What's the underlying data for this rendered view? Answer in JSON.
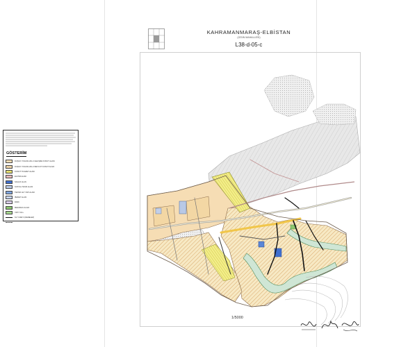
{
  "header": {
    "title": "KAHRAMANMARAŞ-ELBİSTAN",
    "subtitle": "(İZGİN MAHALLESİ)",
    "sheet_code": "L38-d-05-c"
  },
  "legend": {
    "title": "GÖSTERİM",
    "items": [
      {
        "label": "DÜŞÜK YOĞUNLUKLU GELİŞME KONUT ALANI"
      },
      {
        "label": "DÜŞÜK YOĞUNLUKLU MEVCUT KONUT ALANI"
      },
      {
        "label": "KONUT TİCARET ALANI"
      },
      {
        "label": "EĞİTİM ALANI"
      },
      {
        "label": "SAĞLIK ALANI"
      },
      {
        "label": "SOSYAL TESİS ALANI"
      },
      {
        "label": "TEKNİK ALT YAPI ALANI"
      },
      {
        "label": "İBADET ALANI"
      },
      {
        "label": "PARK"
      },
      {
        "label": "MEZARLIK ALANI"
      },
      {
        "label": "YAPI YOLU"
      },
      {
        "label": "SU YÜZEYİ (DERELER)"
      }
    ]
  },
  "footer": {
    "scale": "1/5000"
  }
}
